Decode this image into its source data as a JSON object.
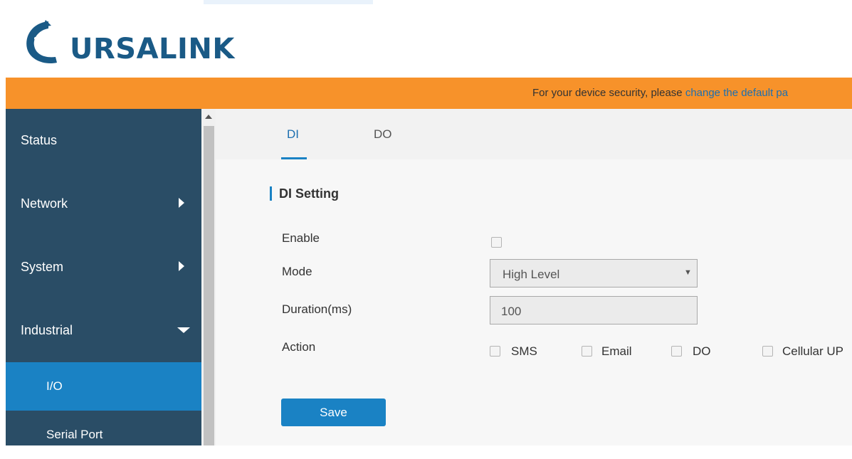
{
  "brand": {
    "name": "URSALINK"
  },
  "banner": {
    "text": "For your device security, please ",
    "link": "change the default pa"
  },
  "sidebar": {
    "items": [
      {
        "label": "Status"
      },
      {
        "label": "Network"
      },
      {
        "label": "System"
      },
      {
        "label": "Industrial"
      }
    ],
    "subitems": [
      {
        "label": "I/O"
      },
      {
        "label": "Serial Port"
      }
    ]
  },
  "tabs": [
    {
      "label": "DI"
    },
    {
      "label": "DO"
    }
  ],
  "section": {
    "title": "DI Setting"
  },
  "form": {
    "enable_label": "Enable",
    "mode_label": "Mode",
    "mode_value": "High Level",
    "duration_label": "Duration(ms)",
    "duration_value": "100",
    "action_label": "Action",
    "actions": [
      "SMS",
      "Email",
      "DO",
      "Cellular UP"
    ]
  },
  "save_label": "Save",
  "colors": {
    "banner": "#f7922a",
    "sidebar": "#2a4d66",
    "accent": "#1a82c4",
    "logo": "#1a5a86"
  }
}
